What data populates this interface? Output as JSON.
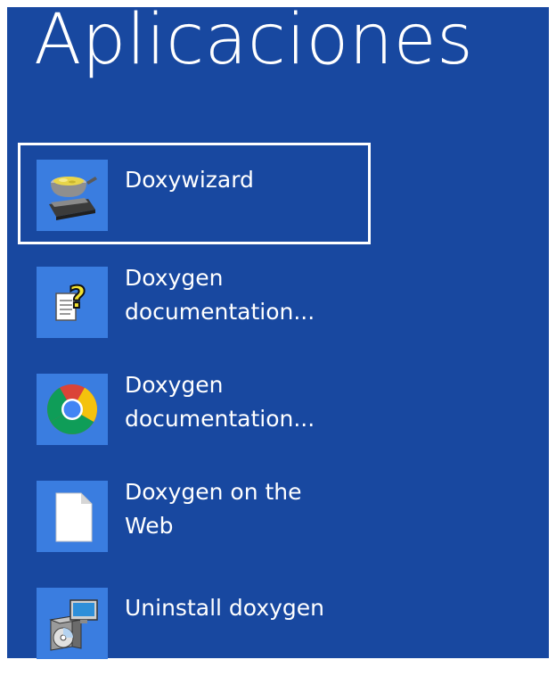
{
  "page": {
    "title": "Aplicaciones"
  },
  "apps": [
    {
      "label": "Doxywizard",
      "icon": "doxywizard-icon",
      "selected": true
    },
    {
      "label": "Doxygen documentation...",
      "icon": "help-document-icon",
      "selected": false
    },
    {
      "label": "Doxygen documentation...",
      "icon": "chrome-icon",
      "selected": false
    },
    {
      "label": "Doxygen on the Web",
      "icon": "blank-document-icon",
      "selected": false
    },
    {
      "label": "Uninstall doxygen",
      "icon": "installer-icon",
      "selected": false
    }
  ],
  "colors": {
    "background": "#1848a0",
    "tile_icon_background": "#3a7de0",
    "text": "#ffffff",
    "selection_border": "#ffffff"
  }
}
